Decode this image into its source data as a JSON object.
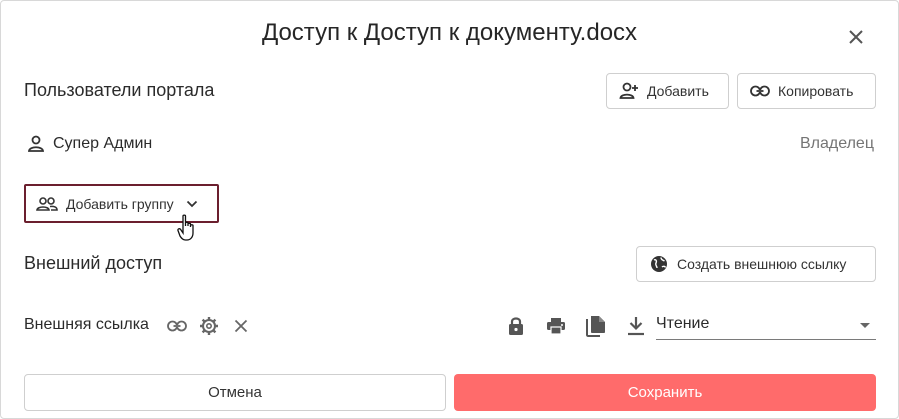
{
  "dialog": {
    "title": "Доступ к Доступ к документу.docx",
    "close_icon": "close-icon"
  },
  "portal_users": {
    "title": "Пользователи портала",
    "add_label": "Добавить",
    "add_icon": "person-add-icon",
    "copy_label": "Копировать",
    "copy_icon": "link-icon",
    "users": [
      {
        "name": "Супер Админ",
        "role": "Владелец",
        "icon": "person-icon"
      }
    ],
    "add_group_label": "Добавить группу",
    "add_group_icon": "group-icon"
  },
  "external_access": {
    "title": "Внешний доступ",
    "create_link_label": "Создать внешнюю ссылку",
    "create_link_icon": "globe-icon",
    "link_label": "Внешняя ссылка",
    "link_actions": [
      "link-icon",
      "gear-icon",
      "close-icon"
    ],
    "permission_icons": [
      "lock-icon",
      "print-icon",
      "copy-icon",
      "download-icon"
    ],
    "access_level": "Чтение"
  },
  "footer": {
    "cancel_label": "Отмена",
    "save_label": "Сохранить"
  },
  "colors": {
    "save": "#ff6b6b",
    "focus_border": "#6b1f2e"
  }
}
